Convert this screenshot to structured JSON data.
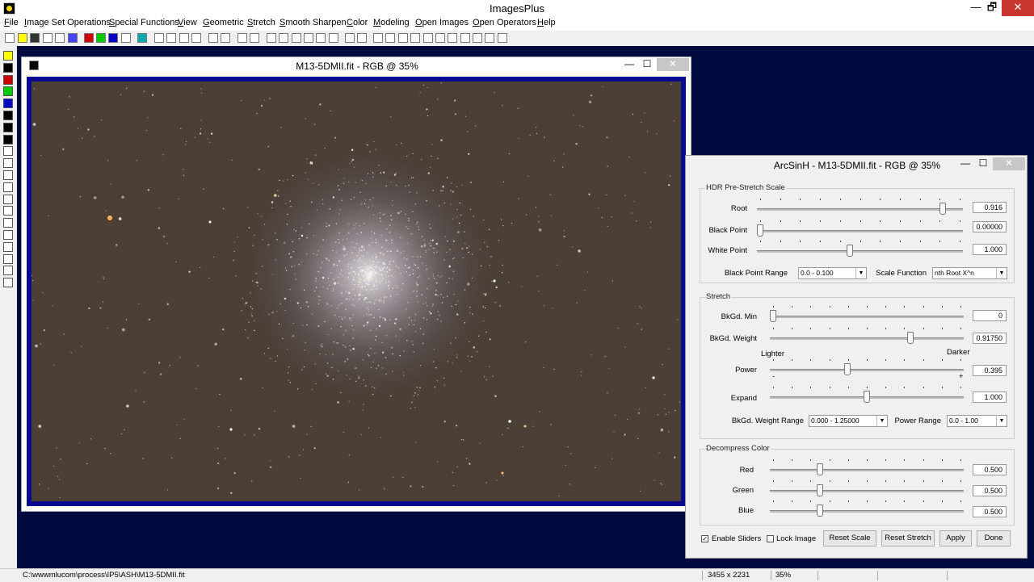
{
  "app": {
    "title": "ImagesPlus",
    "min": "—",
    "max": "🗗",
    "close": "✕"
  },
  "menu": [
    "File",
    "Image Set Operations",
    "Special Functions",
    "View",
    "Geometric",
    "Stretch",
    "Smooth Sharpen",
    "Color",
    "Modeling",
    "Open Images",
    "Open Operators",
    "Help"
  ],
  "image_window": {
    "title": "M13-5DMII.fit - RGB @ 35%",
    "min": "—",
    "max": "☐",
    "close": "✕"
  },
  "dialog": {
    "title": "ArcSinH - M13-5DMII.fit - RGB @ 35%",
    "min": "—",
    "max": "☐",
    "close": "✕",
    "hdr": {
      "group_title": "HDR Pre-Stretch Scale",
      "root_label": "Root",
      "root_value": "0.916",
      "root_pos": 0.916,
      "black_point_label": "Black Point",
      "black_point_value": "0.00000",
      "black_point_pos": 0.0,
      "white_point_label": "White Point",
      "white_point_value": "1.000",
      "white_point_pos": 0.45,
      "black_point_range_label": "Black Point Range",
      "black_point_range_value": "0.0 - 0.100",
      "scale_function_label": "Scale Function",
      "scale_function_value": "nth Root X^n"
    },
    "stretch": {
      "group_title": "Stretch",
      "bkgd_min_label": "BkGd. Min",
      "bkgd_min_value": "0",
      "bkgd_min_pos": 0.0,
      "bkgd_weight_label": "BkGd. Weight",
      "bkgd_weight_value": "0.91750",
      "bkgd_weight_pos": 0.734,
      "lighter": "Lighter",
      "darker": "Darker",
      "power_label": "Power",
      "power_value": "0.395",
      "power_pos": 0.395,
      "expand_label": "Expand",
      "expand_value": "1.000",
      "expand_pos": 0.5,
      "minus": "-",
      "plus": "+",
      "bkgd_weight_range_label": "BkGd. Weight Range",
      "bkgd_weight_range_value": "0.000 - 1.25000",
      "power_range_label": "Power Range",
      "power_range_value": "0.0 - 1.00"
    },
    "decompress": {
      "group_title": "Decompress Color",
      "red_label": "Red",
      "red_value": "0.500",
      "red_pos": 0.25,
      "green_label": "Green",
      "green_value": "0.500",
      "green_pos": 0.25,
      "blue_label": "Blue",
      "blue_value": "0.500",
      "blue_pos": 0.25
    },
    "enable_sliders_label": "Enable Sliders",
    "enable_sliders_checked": true,
    "lock_image_label": "Lock Image",
    "lock_image_checked": false,
    "buttons": {
      "reset_scale": "Reset Scale",
      "reset_stretch": "Reset Stretch",
      "apply": "Apply",
      "done": "Done"
    }
  },
  "status": {
    "path": "C:\\wwwmlucom\\process\\IP5\\ASH\\M13-5DMII.fit",
    "dimensions": "3455 x 2231",
    "zoom": "35%"
  },
  "colors": {
    "desktop": "#000a3f",
    "image_frame": "#0a0a90",
    "sky": "#4b3f36",
    "close_red": "#c7372f"
  }
}
